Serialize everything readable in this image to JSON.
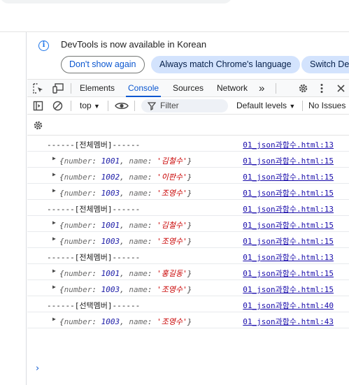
{
  "infobar": {
    "message": "DevTools is now available in Korean",
    "dont_show": "Don't show again",
    "match_language": "Always match Chrome's language",
    "switch": "Switch Dev"
  },
  "tabs": {
    "elements": "Elements",
    "console": "Console",
    "sources": "Sources",
    "network": "Network",
    "more": "»"
  },
  "filterbar": {
    "context": "top",
    "filter_placeholder": "Filter",
    "levels": "Default levels",
    "issues": "No Issues"
  },
  "console_rows": [
    {
      "type": "log",
      "text": "------[전체멤버]------",
      "source": "01_json과함수.html:13"
    },
    {
      "type": "obj",
      "number": "1001",
      "name": "'김철수'",
      "source": "01_json과함수.html:15"
    },
    {
      "type": "obj",
      "number": "1002",
      "name": "'이판수'",
      "source": "01_json과함수.html:15"
    },
    {
      "type": "obj",
      "number": "1003",
      "name": "'조영수'",
      "source": "01_json과함수.html:15"
    },
    {
      "type": "log",
      "text": "------[전체멤버]------",
      "source": "01_json과함수.html:13"
    },
    {
      "type": "obj",
      "number": "1001",
      "name": "'김철수'",
      "source": "01_json과함수.html:15"
    },
    {
      "type": "obj",
      "number": "1003",
      "name": "'조영수'",
      "source": "01_json과함수.html:15"
    },
    {
      "type": "log",
      "text": "------[전체멤버]------",
      "source": "01_json과함수.html:13"
    },
    {
      "type": "obj",
      "number": "1001",
      "name": "'홍길동'",
      "source": "01_json과함수.html:15"
    },
    {
      "type": "obj",
      "number": "1003",
      "name": "'조영수'",
      "source": "01_json과함수.html:15"
    },
    {
      "type": "log",
      "text": "------[선택멤버]------",
      "source": "01_json과함수.html:40"
    },
    {
      "type": "obj",
      "number": "1003",
      "name": "'조영수'",
      "source": "01_json과함수.html:43"
    }
  ],
  "object_keys": {
    "number": "number",
    "name": "name"
  },
  "prompt": "›",
  "colors": {
    "accent": "#0b57d0",
    "link": "#1a0dab",
    "string": "#c80000",
    "number": "#1a1aa6"
  }
}
